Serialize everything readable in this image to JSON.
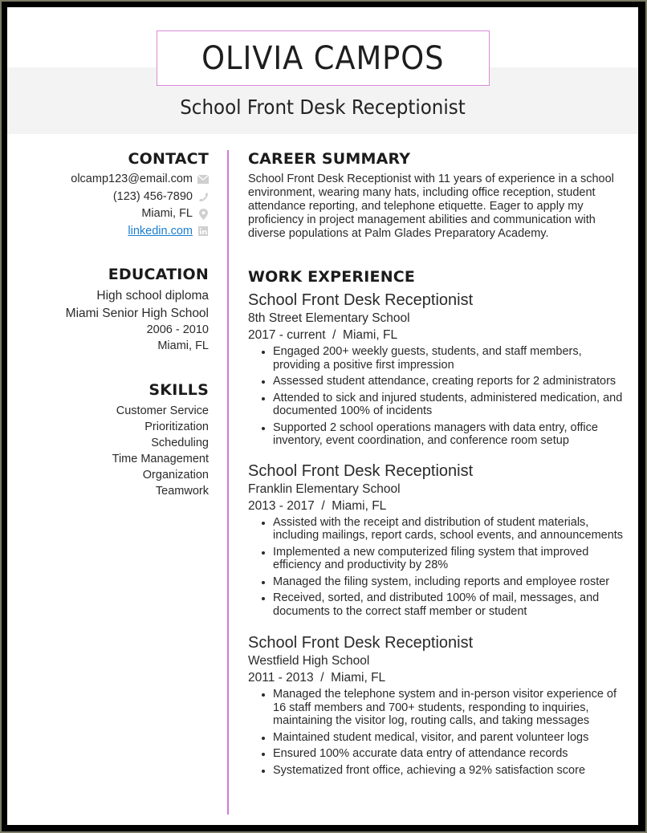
{
  "header": {
    "name": "OLIVIA CAMPOS",
    "title": "School Front Desk Receptionist"
  },
  "colors": {
    "accent": "#d27ad7",
    "link": "#1a7dd0",
    "band": "#f3f3f3"
  },
  "contact": {
    "heading": "CONTACT",
    "items": [
      {
        "text": "olcamp123@email.com",
        "icon": "envelope-icon"
      },
      {
        "text": "(123) 456-7890",
        "icon": "phone-icon"
      },
      {
        "text": "Miami, FL",
        "icon": "map-pin-icon"
      },
      {
        "text": "linkedin.com",
        "icon": "linkedin-icon"
      }
    ]
  },
  "education": {
    "heading": "EDUCATION",
    "degree": "High school diploma",
    "school": "Miami Senior High School",
    "years": "2006 - 2010",
    "location": "Miami, FL"
  },
  "skills": {
    "heading": "SKILLS",
    "items": [
      "Customer Service",
      "Prioritization",
      "Scheduling",
      "Time Management",
      "Organization",
      "Teamwork"
    ]
  },
  "summary": {
    "heading": "CAREER SUMMARY",
    "text": "School Front Desk Receptionist with 11 years of experience in a school environment, wearing many hats, including office reception, student attendance reporting, and telephone etiquette. Eager to apply my proficiency in project management abilities and communication with diverse populations at Palm Glades Preparatory Academy."
  },
  "experience": {
    "heading": "WORK EXPERIENCE",
    "jobs": [
      {
        "title": "School Front Desk Receptionist",
        "employer": "8th Street Elementary School",
        "dates_location": "2017 - current  /  Miami, FL",
        "bullets": [
          "Engaged 200+ weekly guests, students, and staff members, providing a positive first impression",
          "Assessed student attendance, creating reports for 2 administrators",
          "Attended to sick and injured students, administered medication, and documented 100% of incidents",
          "Supported 2 school operations managers with data entry, office inventory, event coordination, and conference room setup"
        ]
      },
      {
        "title": "School Front Desk Receptionist",
        "employer": "Franklin Elementary School",
        "dates_location": "2013 - 2017  /  Miami, FL",
        "bullets": [
          "Assisted with the receipt and distribution of student materials, including mailings, report cards, school events, and announcements",
          "Implemented a new computerized filing system that improved efficiency and productivity by 28%",
          "Managed the filing system, including reports and employee roster",
          "Received, sorted, and distributed 100% of mail, messages, and documents to the correct staff member or student"
        ]
      },
      {
        "title": "School Front Desk Receptionist",
        "employer": "Westfield High School",
        "dates_location": "2011 - 2013  /  Miami, FL",
        "bullets": [
          "Managed the telephone system and in-person visitor experience of 16 staff members and 700+ students, responding to inquiries, maintaining the visitor log, routing calls, and taking messages",
          "Maintained student medical, visitor, and parent volunteer logs",
          "Ensured 100% accurate data entry of attendance records",
          "Systematized front office, achieving a 92% satisfaction score"
        ]
      }
    ]
  }
}
